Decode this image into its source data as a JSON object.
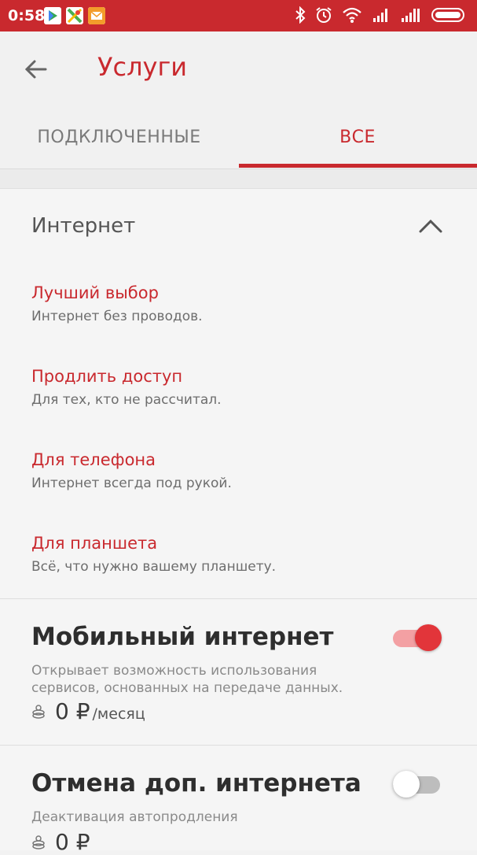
{
  "status_bar": {
    "time": "0:58"
  },
  "header": {
    "title": "Услуги"
  },
  "tabs": [
    {
      "label": "ПОДКЛЮЧЕННЫЕ"
    },
    {
      "label": "ВСЕ"
    }
  ],
  "section": {
    "title": "Интернет",
    "items": [
      {
        "title": "Лучший выбор",
        "subtitle": "Интернет без проводов."
      },
      {
        "title": "Продлить доступ",
        "subtitle": "Для тех, кто не рассчитал."
      },
      {
        "title": "Для телефона",
        "subtitle": "Интернет всегда под рукой."
      },
      {
        "title": "Для планшета",
        "subtitle": "Всё, что нужно вашему планшету."
      }
    ]
  },
  "services": [
    {
      "title": "Мобильный интернет",
      "description": "Открывает возможность использования сервисов, основанных на передаче данных.",
      "price": "0 ₽",
      "unit": "/месяц",
      "enabled": true
    },
    {
      "title": "Отмена доп. интернета",
      "description": "Деактивация автопродления",
      "price": "0 ₽",
      "enabled": false
    }
  ],
  "colors": {
    "accent": "#c9292e",
    "toggle_on_track": "#f3a0a3",
    "toggle_on_thumb": "#e2353a",
    "toggle_off_track": "#bdbdbd",
    "toggle_off_thumb": "#ffffff"
  },
  "icons": {
    "status_left": [
      "play-store-icon",
      "maps-icon",
      "mail-icon"
    ],
    "status_right": [
      "bluetooth-icon",
      "alarm-icon",
      "wifi-icon",
      "signal-icon",
      "signal-icon",
      "battery-icon"
    ],
    "back": "back-arrow-icon",
    "collapse": "chevron-up-icon",
    "price": "coins-icon"
  }
}
